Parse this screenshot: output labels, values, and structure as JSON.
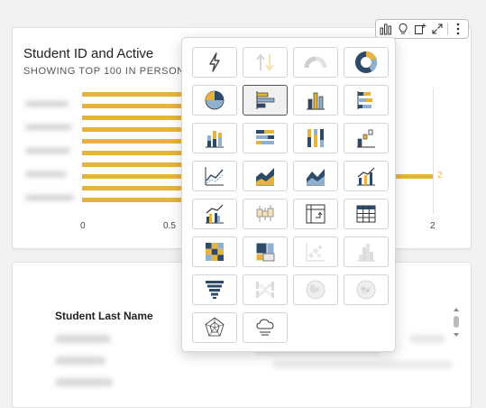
{
  "chart_visual": {
    "title": "Student ID and Active",
    "subtitle": "SHOWING TOP 100 IN PERSON_",
    "x_ticks_left": [
      "0",
      "0.5"
    ],
    "x_tick_right": "2",
    "bar_value_label": "2",
    "bar_color": "#e7b43b"
  },
  "toolbar": {
    "buttons": [
      {
        "icon": "bar-chart-icon"
      },
      {
        "icon": "lightbulb-icon"
      },
      {
        "icon": "add-visual-icon"
      },
      {
        "icon": "expand-icon"
      },
      {
        "icon": "more-options-icon"
      }
    ]
  },
  "table": {
    "column_header": "Student Last Name"
  },
  "visual_type_picker": {
    "selected": "horizontal-bar",
    "rows": [
      [
        "kpi",
        "pivot-arrows",
        "gauge",
        "donut"
      ],
      [
        "pie",
        "horizontal-bar",
        "vertical-bar",
        "horizontal-stacked-bar"
      ],
      [
        "vertical-stacked-bar",
        "horizontal-100-stacked-bar",
        "vertical-100-stacked-bar",
        "waterfall"
      ],
      [
        "line",
        "area",
        "stacked-area",
        "bar-and-line"
      ],
      [
        "clustered-bar-combo",
        "box-plot",
        "pivot-table",
        "table"
      ],
      [
        "heat-map",
        "tree-map",
        "scatter",
        "histogram"
      ],
      [
        "funnel",
        "sankey",
        "filled-map",
        "points-on-map"
      ],
      [
        "radar",
        "word-cloud"
      ]
    ],
    "disabled": [
      "pivot-arrows",
      "gauge",
      "scatter",
      "histogram",
      "sankey",
      "filled-map",
      "points-on-map"
    ]
  }
}
